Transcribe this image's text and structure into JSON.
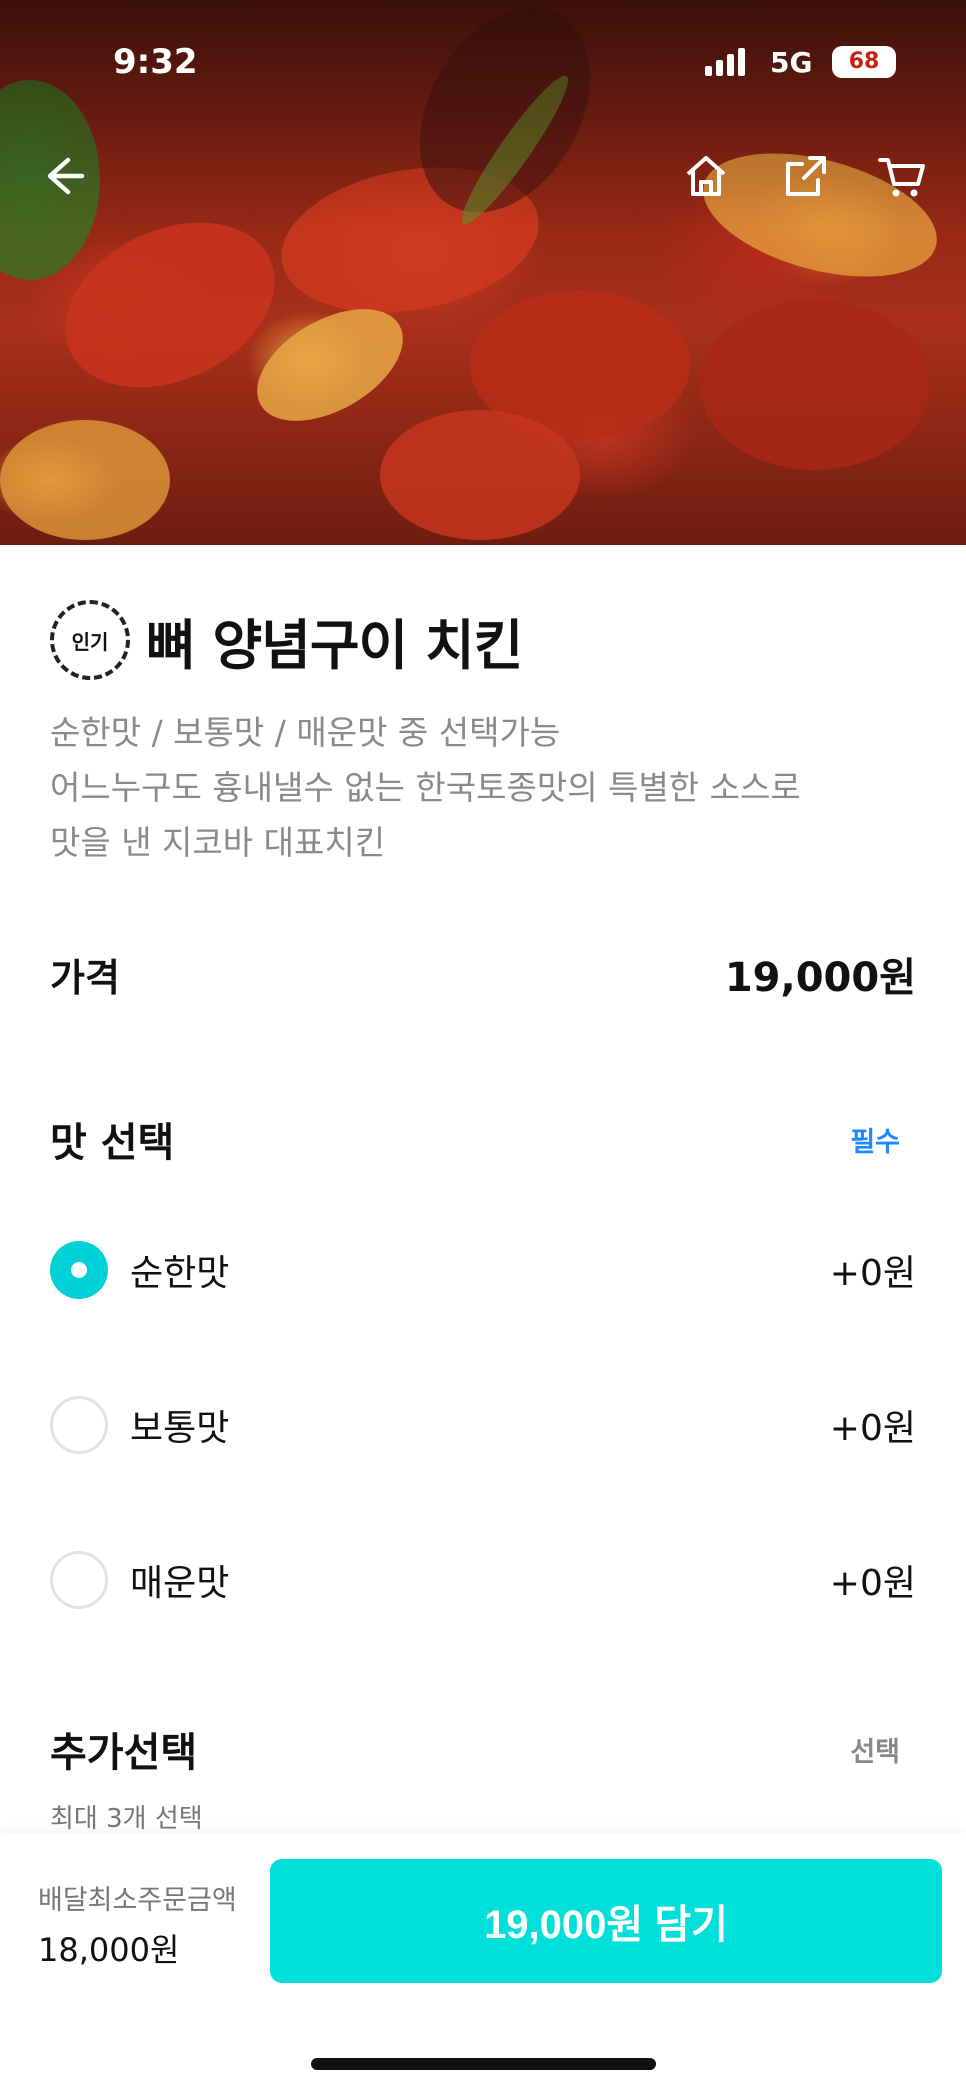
{
  "status_bar": {
    "time": "9:32",
    "network": "5G",
    "battery": "68"
  },
  "nav": {
    "back_icon": "arrow-left-icon",
    "home_icon": "home-icon",
    "share_icon": "share-icon",
    "cart_icon": "cart-icon"
  },
  "product": {
    "badge": "인기",
    "name": "뼈 양념구이 치킨",
    "description_lines": [
      "순한맛 / 보통맛 / 매운맛 중 선택가능",
      "어느누구도 흉내낼수 없는 한국토종맛의 특별한 소스로",
      "맛을 낸 지코바 대표치킨"
    ],
    "price_label": "가격",
    "price_value": "19,000원"
  },
  "flavor_section": {
    "title": "맛 선택",
    "badge": "필수",
    "options": [
      {
        "label": "순한맛",
        "price": "+0원",
        "selected": true
      },
      {
        "label": "보통맛",
        "price": "+0원",
        "selected": false
      },
      {
        "label": "매운맛",
        "price": "+0원",
        "selected": false
      }
    ]
  },
  "extra_section": {
    "title": "추가선택",
    "badge": "선택",
    "subtitle": "최대 3개 선택"
  },
  "bottom_bar": {
    "min_order_label": "배달최소주문금액",
    "min_order_value": "18,000원",
    "add_button_label": "19,000원 담기"
  },
  "colors": {
    "accent": "#00e0da",
    "required": "#1e88ff"
  }
}
